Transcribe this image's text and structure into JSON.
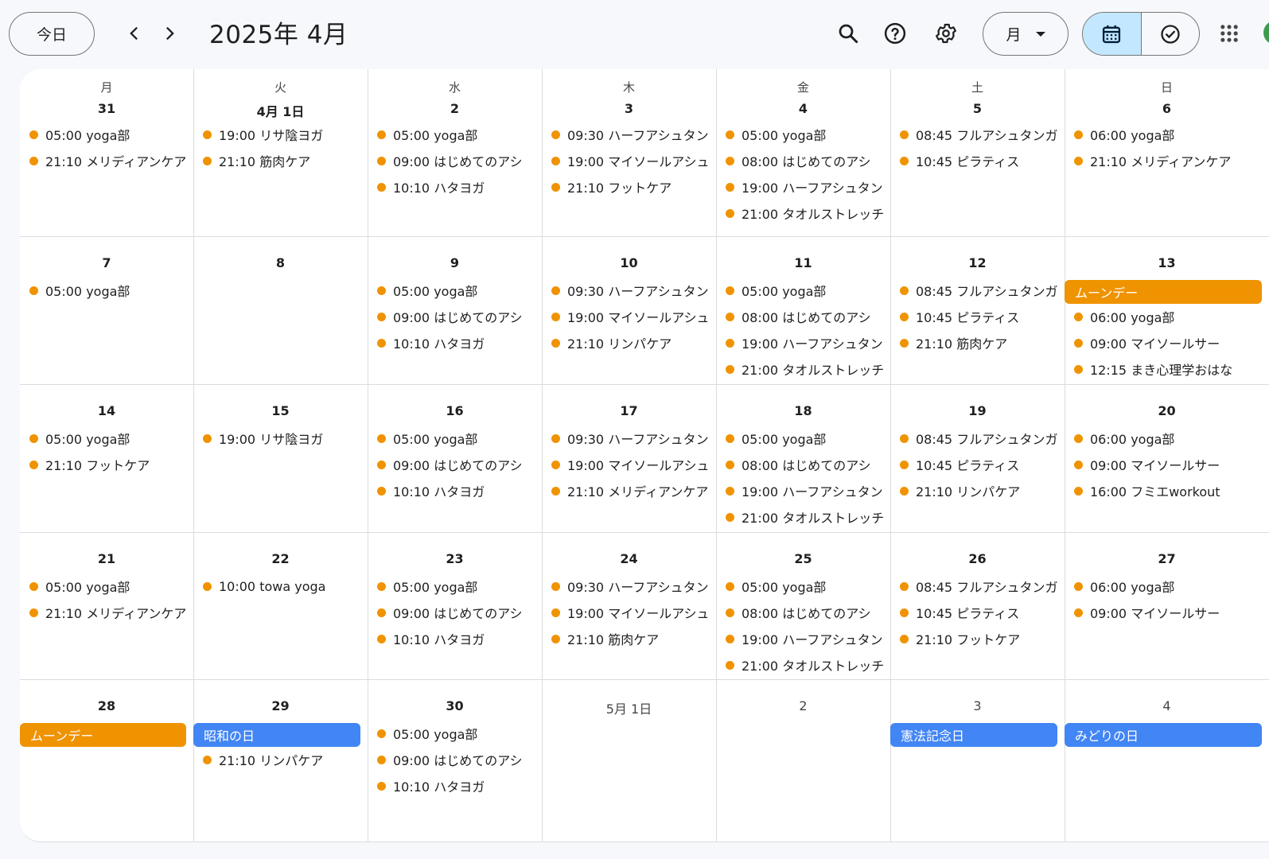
{
  "header": {
    "today_label": "今日",
    "month_title": "2025年 4月",
    "view_label": "月",
    "icons": [
      "chevron-left-icon",
      "chevron-right-icon",
      "search-icon",
      "help-icon",
      "gear-icon",
      "calendar-icon",
      "task-check-icon",
      "apps-grid-icon"
    ]
  },
  "colors": {
    "event_dot": "#f09300",
    "chip_orange": "#f09300",
    "chip_blue": "#4285f4",
    "active_view_bg": "#c2e7ff",
    "background": "#f6f8fc"
  },
  "weekdays": [
    "月",
    "火",
    "水",
    "木",
    "金",
    "土",
    "日"
  ],
  "weeks": [
    [
      {
        "label": "31",
        "current": true,
        "events": [
          "05:00 yoga部",
          "21:10 メリディアンケア"
        ]
      },
      {
        "label": "4月 1日",
        "current": true,
        "events": [
          "19:00 リサ陰ヨガ",
          "21:10 筋肉ケア"
        ]
      },
      {
        "label": "2",
        "current": true,
        "events": [
          "05:00 yoga部",
          "09:00 はじめてのアシ",
          "10:10 ハタヨガ"
        ]
      },
      {
        "label": "3",
        "current": true,
        "events": [
          "09:30 ハーフアシュタン",
          "19:00 マイソールアシュ",
          "21:10 フットケア"
        ]
      },
      {
        "label": "4",
        "current": true,
        "events": [
          "05:00 yoga部",
          "08:00 はじめてのアシ",
          "19:00 ハーフアシュタン",
          "21:00 タオルストレッチ"
        ]
      },
      {
        "label": "5",
        "current": true,
        "events": [
          "08:45 フルアシュタンガ",
          "10:45 ピラティス"
        ]
      },
      {
        "label": "6",
        "current": true,
        "events": [
          "06:00 yoga部",
          "21:10 メリディアンケア"
        ]
      }
    ],
    [
      {
        "label": "7",
        "current": true,
        "events": [
          "05:00 yoga部"
        ]
      },
      {
        "label": "8",
        "current": true,
        "events": []
      },
      {
        "label": "9",
        "current": true,
        "events": [
          "05:00 yoga部",
          "09:00 はじめてのアシ",
          "10:10 ハタヨガ"
        ]
      },
      {
        "label": "10",
        "current": true,
        "events": [
          "09:30 ハーフアシュタン",
          "19:00 マイソールアシュ",
          "21:10 リンパケア"
        ]
      },
      {
        "label": "11",
        "current": true,
        "events": [
          "05:00 yoga部",
          "08:00 はじめてのアシ",
          "19:00 ハーフアシュタン",
          "21:00 タオルストレッチ"
        ]
      },
      {
        "label": "12",
        "current": true,
        "events": [
          "08:45 フルアシュタンガ",
          "10:45 ピラティス",
          "21:10 筋肉ケア"
        ]
      },
      {
        "label": "13",
        "current": true,
        "chip": {
          "text": "ムーンデー",
          "color": "orange"
        },
        "events": [
          "06:00 yoga部",
          "09:00 マイソールサー",
          "12:15 まき心理学おはな"
        ]
      }
    ],
    [
      {
        "label": "14",
        "current": true,
        "events": [
          "05:00 yoga部",
          "21:10 フットケア"
        ]
      },
      {
        "label": "15",
        "current": true,
        "events": [
          "19:00 リサ陰ヨガ"
        ]
      },
      {
        "label": "16",
        "current": true,
        "events": [
          "05:00 yoga部",
          "09:00 はじめてのアシ",
          "10:10 ハタヨガ"
        ]
      },
      {
        "label": "17",
        "current": true,
        "events": [
          "09:30 ハーフアシュタン",
          "19:00 マイソールアシュ",
          "21:10 メリディアンケア"
        ]
      },
      {
        "label": "18",
        "current": true,
        "events": [
          "05:00 yoga部",
          "08:00 はじめてのアシ",
          "19:00 ハーフアシュタン",
          "21:00 タオルストレッチ"
        ]
      },
      {
        "label": "19",
        "current": true,
        "events": [
          "08:45 フルアシュタンガ",
          "10:45 ピラティス",
          "21:10 リンパケア"
        ]
      },
      {
        "label": "20",
        "current": true,
        "events": [
          "06:00 yoga部",
          "09:00 マイソールサー",
          "16:00 フミエworkout"
        ]
      }
    ],
    [
      {
        "label": "21",
        "current": true,
        "events": [
          "05:00 yoga部",
          "21:10 メリディアンケア"
        ]
      },
      {
        "label": "22",
        "current": true,
        "events": [
          "10:00 towa yoga"
        ]
      },
      {
        "label": "23",
        "current": true,
        "events": [
          "05:00 yoga部",
          "09:00 はじめてのアシ",
          "10:10 ハタヨガ"
        ]
      },
      {
        "label": "24",
        "current": true,
        "events": [
          "09:30 ハーフアシュタン",
          "19:00 マイソールアシュ",
          "21:10 筋肉ケア"
        ]
      },
      {
        "label": "25",
        "current": true,
        "events": [
          "05:00 yoga部",
          "08:00 はじめてのアシ",
          "19:00 ハーフアシュタン",
          "21:00 タオルストレッチ"
        ]
      },
      {
        "label": "26",
        "current": true,
        "events": [
          "08:45 フルアシュタンガ",
          "10:45 ピラティス",
          "21:10 フットケア"
        ]
      },
      {
        "label": "27",
        "current": true,
        "events": [
          "06:00 yoga部",
          "09:00 マイソールサー"
        ]
      }
    ],
    [
      {
        "label": "28",
        "current": true,
        "chip": {
          "text": "ムーンデー",
          "color": "orange"
        },
        "events": []
      },
      {
        "label": "29",
        "current": true,
        "chip": {
          "text": "昭和の日",
          "color": "blue"
        },
        "events": [
          "21:10 リンパケア"
        ]
      },
      {
        "label": "30",
        "current": true,
        "events": [
          "05:00 yoga部",
          "09:00 はじめてのアシ",
          "10:10 ハタヨガ"
        ]
      },
      {
        "label": "5月 1日",
        "current": false,
        "events": []
      },
      {
        "label": "2",
        "current": false,
        "events": []
      },
      {
        "label": "3",
        "current": false,
        "chip": {
          "text": "憲法記念日",
          "color": "blue"
        },
        "events": []
      },
      {
        "label": "4",
        "current": false,
        "chip": {
          "text": "みどりの日",
          "color": "blue"
        },
        "events": []
      }
    ]
  ]
}
